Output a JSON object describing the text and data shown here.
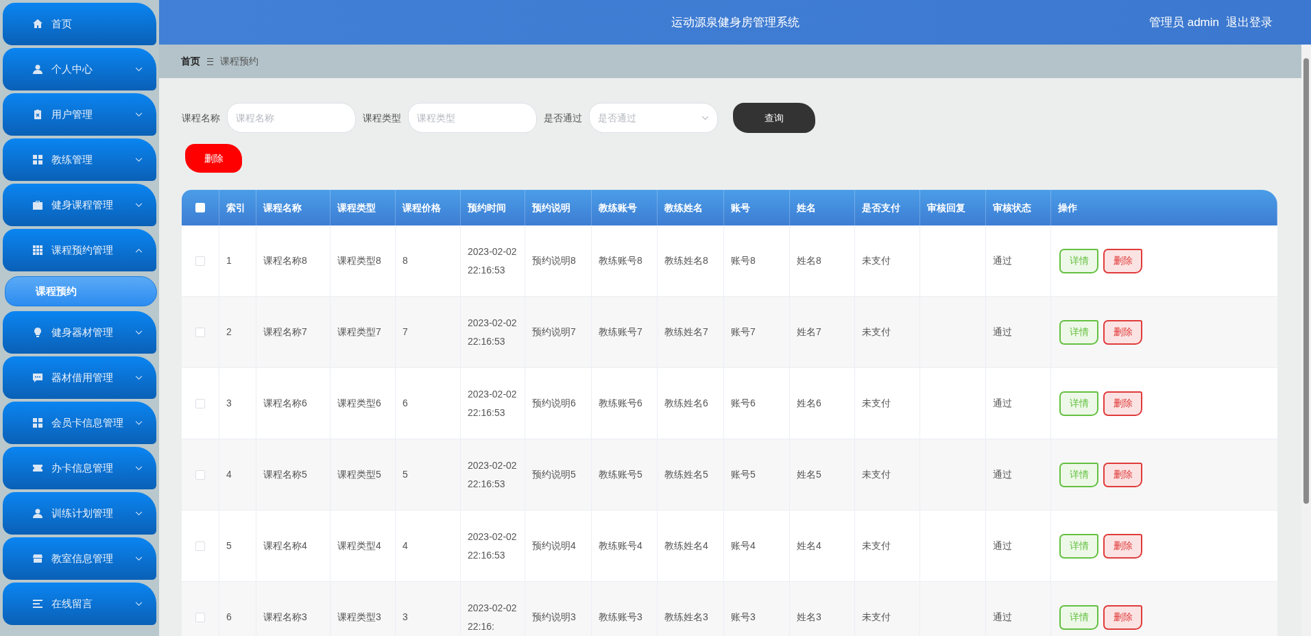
{
  "sidebar": {
    "items": [
      {
        "label": "首页",
        "kind": "link"
      },
      {
        "label": "个人中心",
        "kind": "menu",
        "expanded": false
      },
      {
        "label": "用户管理",
        "kind": "menu",
        "expanded": false
      },
      {
        "label": "教练管理",
        "kind": "menu",
        "expanded": false
      },
      {
        "label": "健身课程管理",
        "kind": "menu",
        "expanded": false
      },
      {
        "label": "课程预约管理",
        "kind": "menu",
        "expanded": true,
        "children": [
          {
            "label": "课程预约",
            "selected": true
          }
        ]
      },
      {
        "label": "健身器材管理",
        "kind": "menu",
        "expanded": false
      },
      {
        "label": "器材借用管理",
        "kind": "menu",
        "expanded": false
      },
      {
        "label": "会员卡信息管理",
        "kind": "menu",
        "expanded": false
      },
      {
        "label": "办卡信息管理",
        "kind": "menu",
        "expanded": false
      },
      {
        "label": "训练计划管理",
        "kind": "menu",
        "expanded": false
      },
      {
        "label": "教室信息管理",
        "kind": "menu",
        "expanded": false
      },
      {
        "label": "在线留言",
        "kind": "menu",
        "expanded": false
      }
    ]
  },
  "header": {
    "title": "运动源泉健身房管理系统",
    "user": "管理员 admin",
    "logout": "退出登录"
  },
  "breadcrumb": [
    "首页",
    "课程预约"
  ],
  "search": {
    "fields": [
      {
        "label": "课程名称",
        "placeholder": "课程名称",
        "kind": "text"
      },
      {
        "label": "课程类型",
        "placeholder": "课程类型",
        "kind": "text"
      },
      {
        "label": "是否通过",
        "placeholder": "是否通过",
        "kind": "select"
      }
    ],
    "button": "查询"
  },
  "bulk_delete": "删除",
  "table": {
    "header_checked": false,
    "columns": [
      "索引",
      "课程名称",
      "课程类型",
      "课程价格",
      "预约时间",
      "预约说明",
      "教练账号",
      "教练姓名",
      "账号",
      "姓名",
      "是否支付",
      "审核回复",
      "审核状态",
      "操作"
    ],
    "rows": [
      {
        "checked": false,
        "cells": [
          "1",
          "课程名称8",
          "课程类型8",
          "8",
          "2023-02-02 22:16:53",
          "预约说明8",
          "教练账号8",
          "教练姓名8",
          "账号8",
          "姓名8",
          "未支付",
          "",
          "通过"
        ],
        "actions": [
          {
            "label": "详情",
            "kind": "detail"
          },
          {
            "label": "删除",
            "kind": "delete"
          }
        ]
      },
      {
        "checked": false,
        "cells": [
          "2",
          "课程名称7",
          "课程类型7",
          "7",
          "2023-02-02 22:16:53",
          "预约说明7",
          "教练账号7",
          "教练姓名7",
          "账号7",
          "姓名7",
          "未支付",
          "",
          "通过"
        ],
        "actions": [
          {
            "label": "详情",
            "kind": "detail"
          },
          {
            "label": "删除",
            "kind": "delete"
          }
        ]
      },
      {
        "checked": false,
        "cells": [
          "3",
          "课程名称6",
          "课程类型6",
          "6",
          "2023-02-02 22:16:53",
          "预约说明6",
          "教练账号6",
          "教练姓名6",
          "账号6",
          "姓名6",
          "未支付",
          "",
          "通过"
        ],
        "actions": [
          {
            "label": "详情",
            "kind": "detail"
          },
          {
            "label": "删除",
            "kind": "delete"
          }
        ]
      },
      {
        "checked": false,
        "cells": [
          "4",
          "课程名称5",
          "课程类型5",
          "5",
          "2023-02-02 22:16:53",
          "预约说明5",
          "教练账号5",
          "教练姓名5",
          "账号5",
          "姓名5",
          "未支付",
          "",
          "通过"
        ],
        "actions": [
          {
            "label": "详情",
            "kind": "detail"
          },
          {
            "label": "删除",
            "kind": "delete"
          }
        ]
      },
      {
        "checked": false,
        "cells": [
          "5",
          "课程名称4",
          "课程类型4",
          "4",
          "2023-02-02 22:16:53",
          "预约说明4",
          "教练账号4",
          "教练姓名4",
          "账号4",
          "姓名4",
          "未支付",
          "",
          "通过"
        ],
        "actions": [
          {
            "label": "详情",
            "kind": "detail"
          },
          {
            "label": "删除",
            "kind": "delete"
          }
        ]
      },
      {
        "checked": false,
        "cells": [
          "6",
          "课程名称3",
          "课程类型3",
          "3",
          "2023-02-02 22:16:",
          "预约说明3",
          "教练账号3",
          "教练姓名3",
          "账号3",
          "姓名3",
          "未支付",
          "",
          "通过"
        ],
        "actions": [
          {
            "label": "详情",
            "kind": "detail"
          },
          {
            "label": "删除",
            "kind": "delete"
          }
        ]
      }
    ]
  }
}
